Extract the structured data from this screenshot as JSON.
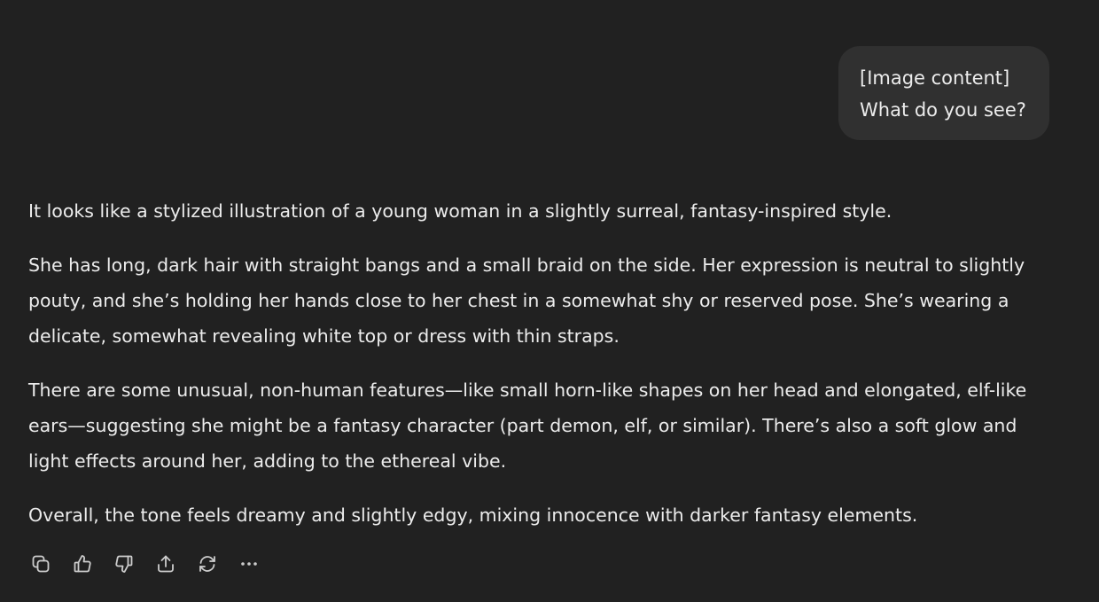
{
  "user_message": {
    "lines": [
      "[Image content]",
      "What do you see?"
    ]
  },
  "assistant_message": {
    "paragraphs": [
      "It looks like a stylized illustration of a young woman in a slightly surreal, fantasy-inspired style.",
      "She has long, dark hair with straight bangs and a small braid on the side. Her expression is neutral to slightly pouty, and she’s holding her hands close to her chest in a somewhat shy or reserved pose. She’s wearing a delicate, somewhat revealing white top or dress with thin straps.",
      "There are some unusual, non-human features—like small horn-like shapes on her head and elongated, elf-like ears—suggesting she might be a fantasy character (part demon, elf, or similar). There’s also a soft glow and light effects around her, adding to the ethereal vibe.",
      "Overall, the tone feels dreamy and slightly edgy, mixing innocence with darker fantasy elements."
    ]
  },
  "action_bar": {
    "icons": [
      "copy-icon",
      "thumbs-up-icon",
      "thumbs-down-icon",
      "share-icon",
      "regenerate-icon",
      "more-icon"
    ]
  },
  "colors": {
    "background": "#212121",
    "user_bubble": "#303030",
    "text": "#ececec",
    "icon": "#cdcdcd"
  }
}
